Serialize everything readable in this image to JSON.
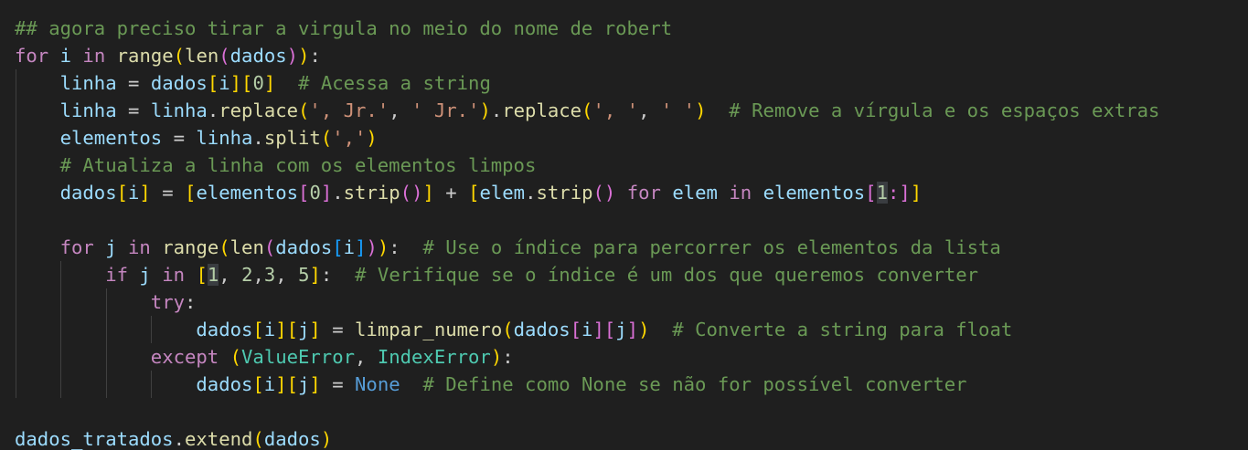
{
  "editor": {
    "background": "#1f1f1f",
    "lines": [
      [
        {
          "t": "## agora preciso tirar a virgula no meio do nome de robert",
          "c": "cm"
        }
      ],
      [
        {
          "t": "for",
          "c": "kw"
        },
        {
          "t": " "
        },
        {
          "t": "i",
          "c": "vr"
        },
        {
          "t": " "
        },
        {
          "t": "in",
          "c": "kw"
        },
        {
          "t": " "
        },
        {
          "t": "range",
          "c": "fn"
        },
        {
          "t": "(",
          "c": "b1"
        },
        {
          "t": "len",
          "c": "fn"
        },
        {
          "t": "(",
          "c": "b2"
        },
        {
          "t": "dados",
          "c": "vr"
        },
        {
          "t": ")",
          "c": "b2"
        },
        {
          "t": ")",
          "c": "b1"
        },
        {
          "t": ":"
        }
      ],
      [
        {
          "t": "    "
        },
        {
          "t": "linha",
          "c": "vr"
        },
        {
          "t": " = "
        },
        {
          "t": "dados",
          "c": "vr"
        },
        {
          "t": "[",
          "c": "b1"
        },
        {
          "t": "i",
          "c": "vr"
        },
        {
          "t": "]",
          "c": "b1"
        },
        {
          "t": "[",
          "c": "b1"
        },
        {
          "t": "0",
          "c": "nu"
        },
        {
          "t": "]",
          "c": "b1"
        },
        {
          "t": "  "
        },
        {
          "t": "# Acessa a string",
          "c": "cm"
        }
      ],
      [
        {
          "t": "    "
        },
        {
          "t": "linha",
          "c": "vr"
        },
        {
          "t": " = "
        },
        {
          "t": "linha",
          "c": "vr"
        },
        {
          "t": "."
        },
        {
          "t": "replace",
          "c": "fn"
        },
        {
          "t": "(",
          "c": "b1"
        },
        {
          "t": "', Jr.'",
          "c": "st"
        },
        {
          "t": ", "
        },
        {
          "t": "' Jr.'",
          "c": "st"
        },
        {
          "t": ")",
          "c": "b1"
        },
        {
          "t": "."
        },
        {
          "t": "replace",
          "c": "fn"
        },
        {
          "t": "(",
          "c": "b1"
        },
        {
          "t": "', '",
          "c": "st"
        },
        {
          "t": ", "
        },
        {
          "t": "' '",
          "c": "st"
        },
        {
          "t": ")",
          "c": "b1"
        },
        {
          "t": "  "
        },
        {
          "t": "# Remove a vírgula e os espaços extras",
          "c": "cm"
        }
      ],
      [
        {
          "t": "    "
        },
        {
          "t": "elementos",
          "c": "vr"
        },
        {
          "t": " = "
        },
        {
          "t": "linha",
          "c": "vr"
        },
        {
          "t": "."
        },
        {
          "t": "split",
          "c": "fn"
        },
        {
          "t": "(",
          "c": "b1"
        },
        {
          "t": "','",
          "c": "st"
        },
        {
          "t": ")",
          "c": "b1"
        }
      ],
      [
        {
          "t": "    "
        },
        {
          "t": "# Atualiza a linha com os elementos limpos",
          "c": "cm"
        }
      ],
      [
        {
          "t": "    "
        },
        {
          "t": "dados",
          "c": "vr"
        },
        {
          "t": "[",
          "c": "b1"
        },
        {
          "t": "i",
          "c": "vr"
        },
        {
          "t": "]",
          "c": "b1"
        },
        {
          "t": " = "
        },
        {
          "t": "[",
          "c": "b1"
        },
        {
          "t": "elementos",
          "c": "vr"
        },
        {
          "t": "[",
          "c": "b2"
        },
        {
          "t": "0",
          "c": "nu"
        },
        {
          "t": "]",
          "c": "b2"
        },
        {
          "t": "."
        },
        {
          "t": "strip",
          "c": "fn"
        },
        {
          "t": "(",
          "c": "b2"
        },
        {
          "t": ")",
          "c": "b2"
        },
        {
          "t": "]",
          "c": "b1"
        },
        {
          "t": " + "
        },
        {
          "t": "[",
          "c": "b1"
        },
        {
          "t": "elem",
          "c": "vr"
        },
        {
          "t": "."
        },
        {
          "t": "strip",
          "c": "fn"
        },
        {
          "t": "(",
          "c": "b2"
        },
        {
          "t": ")",
          "c": "b2"
        },
        {
          "t": " "
        },
        {
          "t": "for",
          "c": "kw"
        },
        {
          "t": " "
        },
        {
          "t": "elem",
          "c": "vr"
        },
        {
          "t": " "
        },
        {
          "t": "in",
          "c": "kw"
        },
        {
          "t": " "
        },
        {
          "t": "elementos",
          "c": "vr"
        },
        {
          "t": "[",
          "c": "b2"
        },
        {
          "t": "1",
          "c": "nu hl"
        },
        {
          "t": ":]",
          "c": "b2"
        },
        {
          "t": "]",
          "c": "b1"
        }
      ],
      [
        {
          "t": ""
        }
      ],
      [
        {
          "t": "    "
        },
        {
          "t": "for",
          "c": "kw"
        },
        {
          "t": " "
        },
        {
          "t": "j",
          "c": "vr"
        },
        {
          "t": " "
        },
        {
          "t": "in",
          "c": "kw"
        },
        {
          "t": " "
        },
        {
          "t": "range",
          "c": "fn"
        },
        {
          "t": "(",
          "c": "b1"
        },
        {
          "t": "len",
          "c": "fn"
        },
        {
          "t": "(",
          "c": "b2"
        },
        {
          "t": "dados",
          "c": "vr"
        },
        {
          "t": "[",
          "c": "b3"
        },
        {
          "t": "i",
          "c": "vr"
        },
        {
          "t": "]",
          "c": "b3"
        },
        {
          "t": ")",
          "c": "b2"
        },
        {
          "t": ")",
          "c": "b1"
        },
        {
          "t": ":  "
        },
        {
          "t": "# Use o índice para percorrer os elementos da lista",
          "c": "cm"
        }
      ],
      [
        {
          "t": "        "
        },
        {
          "t": "if",
          "c": "kw"
        },
        {
          "t": " "
        },
        {
          "t": "j",
          "c": "vr"
        },
        {
          "t": " "
        },
        {
          "t": "in",
          "c": "kw"
        },
        {
          "t": " "
        },
        {
          "t": "[",
          "c": "b1"
        },
        {
          "t": "1",
          "c": "nu hl"
        },
        {
          "t": ", "
        },
        {
          "t": "2",
          "c": "nu"
        },
        {
          "t": ","
        },
        {
          "t": "3",
          "c": "nu"
        },
        {
          "t": ", "
        },
        {
          "t": "5",
          "c": "nu"
        },
        {
          "t": "]",
          "c": "b1"
        },
        {
          "t": ":  "
        },
        {
          "t": "# Verifique se o índice é um dos que queremos converter",
          "c": "cm"
        }
      ],
      [
        {
          "t": "            "
        },
        {
          "t": "try",
          "c": "kw"
        },
        {
          "t": ":"
        }
      ],
      [
        {
          "t": "                "
        },
        {
          "t": "dados",
          "c": "vr"
        },
        {
          "t": "[",
          "c": "b1"
        },
        {
          "t": "i",
          "c": "vr"
        },
        {
          "t": "]",
          "c": "b1"
        },
        {
          "t": "[",
          "c": "b1"
        },
        {
          "t": "j",
          "c": "vr"
        },
        {
          "t": "]",
          "c": "b1"
        },
        {
          "t": " = "
        },
        {
          "t": "limpar_numero",
          "c": "fn"
        },
        {
          "t": "(",
          "c": "b1"
        },
        {
          "t": "dados",
          "c": "vr"
        },
        {
          "t": "[",
          "c": "b2"
        },
        {
          "t": "i",
          "c": "vr"
        },
        {
          "t": "]",
          "c": "b2"
        },
        {
          "t": "[",
          "c": "b2"
        },
        {
          "t": "j",
          "c": "vr"
        },
        {
          "t": "]",
          "c": "b2"
        },
        {
          "t": ")",
          "c": "b1"
        },
        {
          "t": "  "
        },
        {
          "t": "# Converte a string para float",
          "c": "cm"
        }
      ],
      [
        {
          "t": "            "
        },
        {
          "t": "except",
          "c": "kw"
        },
        {
          "t": " "
        },
        {
          "t": "(",
          "c": "b1"
        },
        {
          "t": "ValueError",
          "c": "cl"
        },
        {
          "t": ", "
        },
        {
          "t": "IndexError",
          "c": "cl"
        },
        {
          "t": ")",
          "c": "b1"
        },
        {
          "t": ":"
        }
      ],
      [
        {
          "t": "                "
        },
        {
          "t": "dados",
          "c": "vr"
        },
        {
          "t": "[",
          "c": "b1"
        },
        {
          "t": "i",
          "c": "vr"
        },
        {
          "t": "]",
          "c": "b1"
        },
        {
          "t": "[",
          "c": "b1"
        },
        {
          "t": "j",
          "c": "vr"
        },
        {
          "t": "]",
          "c": "b1"
        },
        {
          "t": " = "
        },
        {
          "t": "None",
          "c": "co"
        },
        {
          "t": "  "
        },
        {
          "t": "# Define como None se não for possível converter",
          "c": "cm"
        }
      ],
      [
        {
          "t": ""
        }
      ],
      [
        {
          "t": "dados_tratados",
          "c": "vr"
        },
        {
          "t": "."
        },
        {
          "t": "extend",
          "c": "fn"
        },
        {
          "t": "(",
          "c": "b1"
        },
        {
          "t": "dados",
          "c": "vr"
        },
        {
          "t": ")",
          "c": "b1"
        }
      ]
    ]
  }
}
